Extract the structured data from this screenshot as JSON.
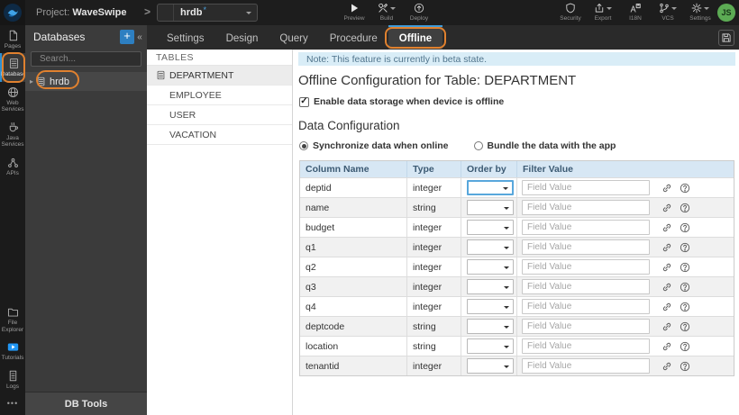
{
  "colors": {
    "accent_blue": "#2f8fd0",
    "annotation_orange": "#e0812f",
    "note_bg": "#d9edf7",
    "table_header_bg": "#d7e7f4",
    "focus_blue": "#58a7dc",
    "avatar_green": "#5cab54",
    "tutorials_blue": "#2196f3"
  },
  "topbar": {
    "project_prefix": "Project:",
    "project_name": "WaveSwipe",
    "db_selector": {
      "value": "hrdb",
      "dirty_marker": "*"
    },
    "actions": [
      {
        "id": "preview",
        "label": "Preview",
        "icon": "preview-icon",
        "caret": false
      },
      {
        "id": "build",
        "label": "Build",
        "icon": "build-icon",
        "caret": true
      },
      {
        "id": "deploy",
        "label": "Deploy",
        "icon": "deploy-icon",
        "caret": false
      }
    ],
    "utilities": [
      {
        "id": "security",
        "label": "Security",
        "icon": "shield-icon",
        "caret": false
      },
      {
        "id": "export",
        "label": "Export",
        "icon": "export-icon",
        "caret": true
      },
      {
        "id": "i18n",
        "label": "I18N",
        "icon": "i18n-icon",
        "caret": false
      },
      {
        "id": "vcs",
        "label": "VCS",
        "icon": "vcs-icon",
        "caret": true
      },
      {
        "id": "settings",
        "label": "Settings",
        "icon": "gear-icon",
        "caret": true
      }
    ],
    "avatar_text": "JS"
  },
  "sidebar": {
    "top_items": [
      {
        "id": "pages",
        "label": "Pages",
        "icon": "pages-icon",
        "active": false,
        "annotated": false
      },
      {
        "id": "databases",
        "label": "Databases",
        "icon": "database-icon",
        "active": true,
        "annotated": true
      },
      {
        "id": "web-services",
        "label": "Web Services",
        "icon": "globe-icon",
        "active": false,
        "annotated": false
      },
      {
        "id": "java-services",
        "label": "Java Services",
        "icon": "java-icon",
        "active": false,
        "annotated": false
      },
      {
        "id": "apis",
        "label": "APIs",
        "icon": "api-icon",
        "active": false,
        "annotated": false
      }
    ],
    "bottom_items": [
      {
        "id": "file-explorer",
        "label": "File Explorer",
        "icon": "folder-icon"
      },
      {
        "id": "tutorials",
        "label": "Tutorials",
        "icon": "tutorials-icon"
      },
      {
        "id": "logs",
        "label": "Logs",
        "icon": "logs-icon"
      }
    ],
    "overflow_label": "•••"
  },
  "db_panel": {
    "title": "Databases",
    "add_label": "+",
    "collapse_glyph": "«",
    "search_placeholder": "Search...",
    "items": [
      {
        "label": "hrdb",
        "annotated": true
      }
    ],
    "footer_label": "DB Tools"
  },
  "workspace": {
    "tabs": [
      {
        "label": "Settings",
        "active": false,
        "annotated": false
      },
      {
        "label": "Design",
        "active": false,
        "annotated": false
      },
      {
        "label": "Query",
        "active": false,
        "annotated": false
      },
      {
        "label": "Procedure",
        "active": false,
        "annotated": false
      },
      {
        "label": "Offline",
        "active": true,
        "annotated": true
      }
    ]
  },
  "tables_panel": {
    "title": "TABLES",
    "items": [
      {
        "label": "DEPARTMENT",
        "selected": true
      },
      {
        "label": "EMPLOYEE",
        "selected": false
      },
      {
        "label": "USER",
        "selected": false
      },
      {
        "label": "VACATION",
        "selected": false
      }
    ]
  },
  "content": {
    "note_text": "Note: This feature is currently in beta state.",
    "title": "Offline Configuration for Table: DEPARTMENT",
    "enable_label": "Enable data storage when device is offline",
    "enable_checked": true,
    "section_title": "Data Configuration",
    "sync_options": [
      {
        "label": "Synchronize data when online",
        "selected": true
      },
      {
        "label": "Bundle the data with the app",
        "selected": false
      }
    ],
    "table": {
      "headers": [
        "Column Name",
        "Type",
        "Order by",
        "Filter Value"
      ],
      "order_by_value": "",
      "filter_placeholder": "Field Value",
      "rows": [
        {
          "name": "deptid",
          "type": "integer",
          "focused": true
        },
        {
          "name": "name",
          "type": "string",
          "focused": false
        },
        {
          "name": "budget",
          "type": "integer",
          "focused": false
        },
        {
          "name": "q1",
          "type": "integer",
          "focused": false
        },
        {
          "name": "q2",
          "type": "integer",
          "focused": false
        },
        {
          "name": "q3",
          "type": "integer",
          "focused": false
        },
        {
          "name": "q4",
          "type": "integer",
          "focused": false
        },
        {
          "name": "deptcode",
          "type": "string",
          "focused": false
        },
        {
          "name": "location",
          "type": "string",
          "focused": false
        },
        {
          "name": "tenantid",
          "type": "integer",
          "focused": false
        }
      ]
    }
  }
}
